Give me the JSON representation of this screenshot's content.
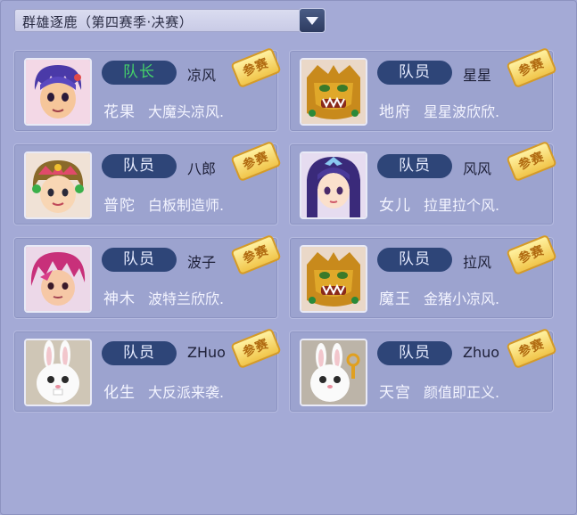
{
  "header": {
    "season_title": "群雄逐鹿（第四赛季·决赛）",
    "dropdown_icon": "triangle-down-icon"
  },
  "members": [
    {
      "role": "队长",
      "captain": true,
      "nickname": "凉风",
      "server": "花果",
      "role_name": "大魔头凉风.",
      "stamp": "参赛",
      "avatar": "boy-purple-hair"
    },
    {
      "role": "队员",
      "captain": false,
      "nickname": "星星",
      "server": "地府",
      "role_name": "星星波欣欣.",
      "stamp": "参赛",
      "avatar": "golden-beast"
    },
    {
      "role": "队员",
      "captain": false,
      "nickname": "八郎",
      "server": "普陀",
      "role_name": "白板制造师.",
      "stamp": "参赛",
      "avatar": "girl-flower-crown"
    },
    {
      "role": "队员",
      "captain": false,
      "nickname": "风风",
      "server": "女儿",
      "role_name": "拉里拉个风.",
      "stamp": "参赛",
      "avatar": "girl-dark-hair"
    },
    {
      "role": "队员",
      "captain": false,
      "nickname": "波子",
      "server": "神木",
      "role_name": "波特兰欣欣.",
      "stamp": "参赛",
      "avatar": "boy-red-hair"
    },
    {
      "role": "队员",
      "captain": false,
      "nickname": "拉风",
      "server": "魔王",
      "role_name": "金猪小凉风.",
      "stamp": "参赛",
      "avatar": "golden-beast"
    },
    {
      "role": "队员",
      "captain": false,
      "nickname": "ZHuo",
      "server": "化生",
      "role_name": "大反派来袭.",
      "stamp": "参赛",
      "avatar": "white-rabbit"
    },
    {
      "role": "队员",
      "captain": false,
      "nickname": "Zhuo",
      "server": "天宫",
      "role_name": "颜值即正义.",
      "stamp": "参赛",
      "avatar": "white-rabbit-key"
    }
  ]
}
